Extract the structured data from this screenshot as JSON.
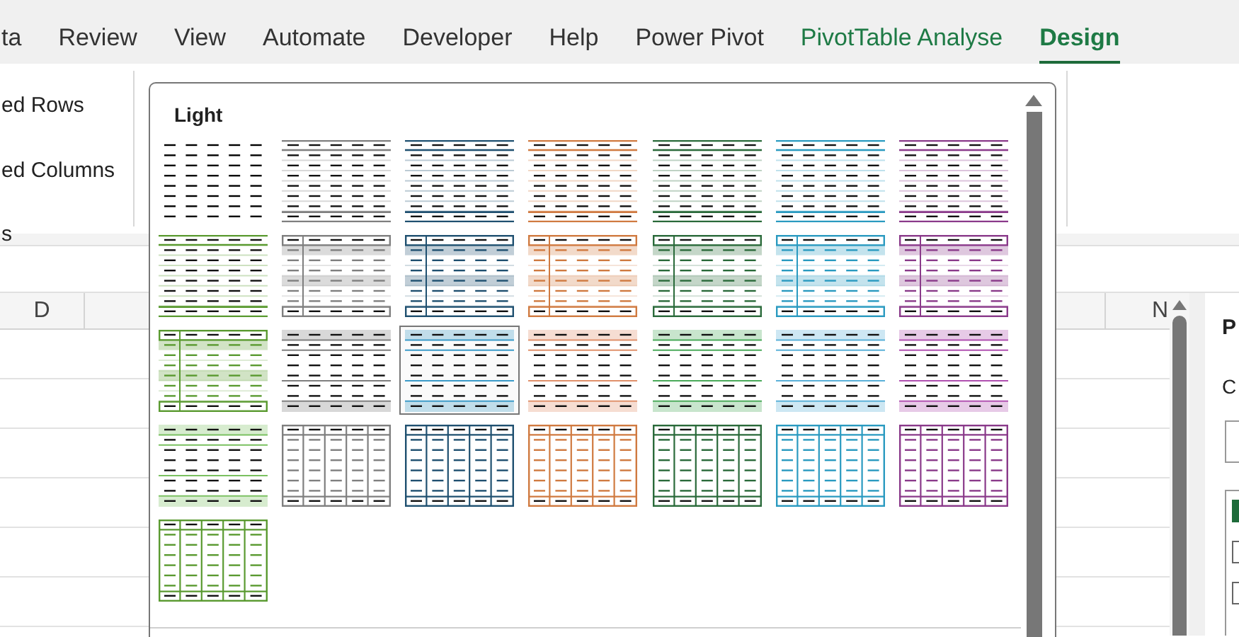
{
  "ribbon_tabs": [
    {
      "label": "ta",
      "selected": false,
      "contextual": false
    },
    {
      "label": "Review",
      "selected": false,
      "contextual": false
    },
    {
      "label": "View",
      "selected": false,
      "contextual": false
    },
    {
      "label": "Automate",
      "selected": false,
      "contextual": false
    },
    {
      "label": "Developer",
      "selected": false,
      "contextual": false
    },
    {
      "label": "Help",
      "selected": false,
      "contextual": false
    },
    {
      "label": "Power Pivot",
      "selected": false,
      "contextual": false
    },
    {
      "label": "PivotTable Analyse",
      "selected": false,
      "contextual": true
    },
    {
      "label": "Design",
      "selected": true,
      "contextual": true
    }
  ],
  "ribbon_options": [
    "ed Rows",
    "ed Columns",
    "s"
  ],
  "column_headers": [
    "D",
    "N"
  ],
  "style_gallery": {
    "heading": "Light",
    "styles": [
      {
        "kind": "none",
        "color": "#000000",
        "selected": false
      },
      {
        "kind": "rules",
        "color": "#7f7f7f",
        "selected": false
      },
      {
        "kind": "rules",
        "color": "#1f5070",
        "selected": false
      },
      {
        "kind": "rules",
        "color": "#d07a40",
        "selected": false
      },
      {
        "kind": "rules",
        "color": "#2a6a3a",
        "selected": false
      },
      {
        "kind": "rules",
        "color": "#2a9ac0",
        "selected": false
      },
      {
        "kind": "rules",
        "color": "#8a3a8a",
        "selected": false
      },
      {
        "kind": "rules",
        "color": "#5a9a30",
        "selected": false
      },
      {
        "kind": "framed",
        "color": "#7f7f7f",
        "selected": false
      },
      {
        "kind": "framed",
        "color": "#1f5070",
        "selected": false
      },
      {
        "kind": "framed",
        "color": "#d07a40",
        "selected": false
      },
      {
        "kind": "framed",
        "color": "#2a6a3a",
        "selected": false
      },
      {
        "kind": "framed",
        "color": "#2a9ac0",
        "selected": false
      },
      {
        "kind": "framed",
        "color": "#8a3a8a",
        "selected": false
      },
      {
        "kind": "framed",
        "color": "#5a9a30",
        "selected": false
      },
      {
        "kind": "banded",
        "color": "#7f7f7f",
        "selected": false
      },
      {
        "kind": "banded",
        "color": "#3a9ac8",
        "selected": true
      },
      {
        "kind": "banded",
        "color": "#e0906a",
        "selected": false
      },
      {
        "kind": "banded",
        "color": "#4aaa5a",
        "selected": false
      },
      {
        "kind": "banded",
        "color": "#5ab0d8",
        "selected": false
      },
      {
        "kind": "banded",
        "color": "#b050b0",
        "selected": false
      },
      {
        "kind": "banded",
        "color": "#7ac060",
        "selected": false
      },
      {
        "kind": "grid",
        "color": "#7f7f7f",
        "selected": false
      },
      {
        "kind": "grid",
        "color": "#1f5070",
        "selected": false
      },
      {
        "kind": "grid",
        "color": "#d07a40",
        "selected": false
      },
      {
        "kind": "grid",
        "color": "#2a6a3a",
        "selected": false
      },
      {
        "kind": "grid",
        "color": "#2a9ac0",
        "selected": false
      },
      {
        "kind": "grid",
        "color": "#8a3a8a",
        "selected": false
      },
      {
        "kind": "grid",
        "color": "#5a9a30",
        "selected": false
      }
    ]
  },
  "side_pane": {
    "title": "P",
    "label": "C",
    "checkboxes": [
      {
        "checked": true
      },
      {
        "checked": false
      },
      {
        "checked": false
      }
    ]
  }
}
